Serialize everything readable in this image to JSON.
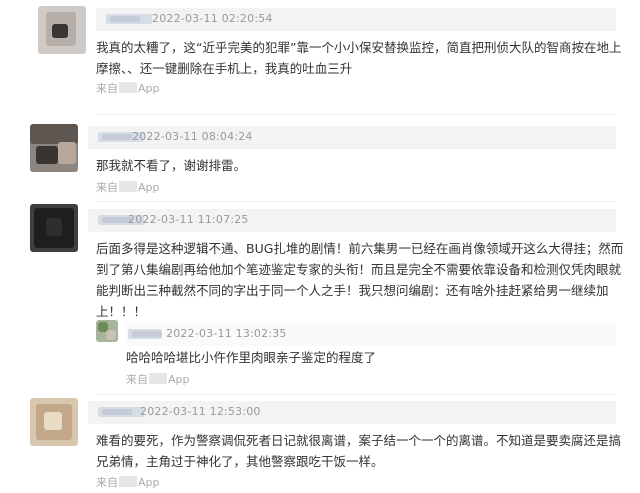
{
  "comments": [
    {
      "time": "2022-03-11 02:20:54",
      "text": "我真的太糟了，这“近乎完美的犯罪”靠一个小小保安替换监控，简直把刑侦大队的智商按在地上摩擦、、还一键删除在手机上，我真的吐血三升",
      "source_prefix": "来自",
      "source_suffix": "App"
    },
    {
      "time": "2022-03-11 08:04:24",
      "text": "那我就不看了，谢谢排雷。",
      "source_prefix": "来自",
      "source_suffix": "App"
    },
    {
      "time": "2022-03-11 11:07:25",
      "text": "后面多得是这种逻辑不通、BUG扎堆的剧情！前六集男一已经在画肖像领域开这么大得挂；然而到了第八集编剧再给他加个笔迹鉴定专家的头衔！而且是完全不需要依靠设备和检测仅凭肉眼就能判断出三种截然不同的字出于同一个人之手！我只想问编剧：还有啥外挂赶紧给男一继续加上！！！",
      "source_prefix": "",
      "source_suffix": "",
      "reply": {
        "time": "2022-03-11 13:02:35",
        "text": "哈哈哈哈堪比小仵作里肉眼亲子鉴定的程度了",
        "source_prefix": "来自",
        "source_suffix": "App"
      }
    },
    {
      "time": "2022-03-11 12:53:00",
      "text": "难看的要死，作为警察调侃死者日记就很离谱，案子结一个一个的离谱。不知道是要卖腐还是搞兄弟情，主角过于神化了，其他警察跟吃干饭一样。",
      "source_prefix": "来自",
      "source_suffix": "App"
    }
  ]
}
